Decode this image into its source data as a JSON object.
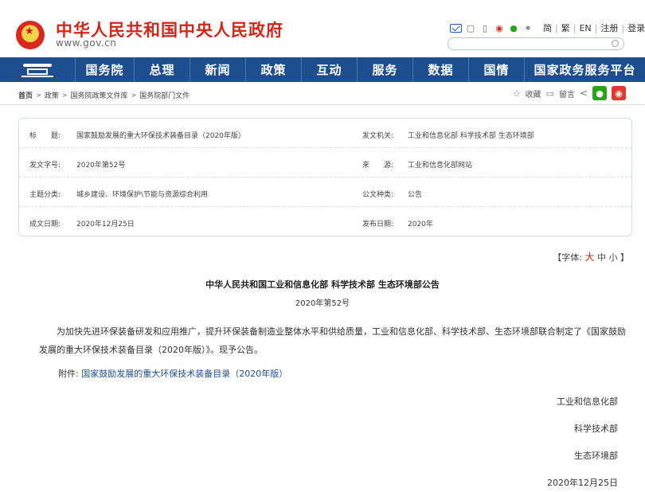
{
  "header": {
    "site_title": "中华人民共和国中央人民政府",
    "site_url": "www.gov.cn",
    "top_links": [
      "简",
      "繁",
      "EN",
      "注册",
      "登录"
    ]
  },
  "nav": {
    "items": [
      "国务院",
      "总理",
      "新闻",
      "政策",
      "互动",
      "服务",
      "数据",
      "国情",
      "国家政务服务平台"
    ]
  },
  "breadcrumb": [
    "首页",
    "政策",
    "国务院政策文件库",
    "国务院部门文件"
  ],
  "tools": {
    "favorite": "收藏",
    "message": "留言"
  },
  "info": {
    "rows": [
      {
        "l1": "标　　题:",
        "v1": "国家鼓励发展的重大环保技术装备目录（2020年版）",
        "l2": "发文机关:",
        "v2": "工业和信息化部  科学技术部  生态环境部"
      },
      {
        "l1": "发文字号:",
        "v1": "2020年第52号",
        "l2": "来　　源:",
        "v2": "工业和信息化部网站"
      },
      {
        "l1": "主题分类:",
        "v1": "城乡建设、环境保护\\节能与资源综合利用",
        "l2": "公文种类:",
        "v2": "公告"
      },
      {
        "l1": "成文日期:",
        "v1": "2020年12月25日",
        "l2": "发布日期:",
        "v2": "2020年"
      }
    ]
  },
  "font_size": {
    "prefix": "【字体:",
    "large": "大",
    "medium": "中",
    "small": "小",
    "suffix": "】"
  },
  "article": {
    "title": "中华人民共和国工业和信息化部 科学技术部 生态环境部公告",
    "doc_no": "2020年第52号",
    "paragraph": "为加快先进环保装备研发和应用推广，提升环保装备制造业整体水平和供给质量，工业和信息化部、科学技术部、生态环境部联合制定了《国家鼓励发展的重大环保技术装备目录（2020年版）》。现予公告。",
    "attachment_label": "附件:",
    "attachment_link": "国家鼓励发展的重大环保技术装备目录（2020年版）",
    "signatures": [
      "工业和信息化部",
      "科学技术部",
      "生态环境部"
    ],
    "date": "2020年12月25日"
  },
  "colors": {
    "brand_red": "#d1261a",
    "nav_blue": "#1d4f8f"
  }
}
